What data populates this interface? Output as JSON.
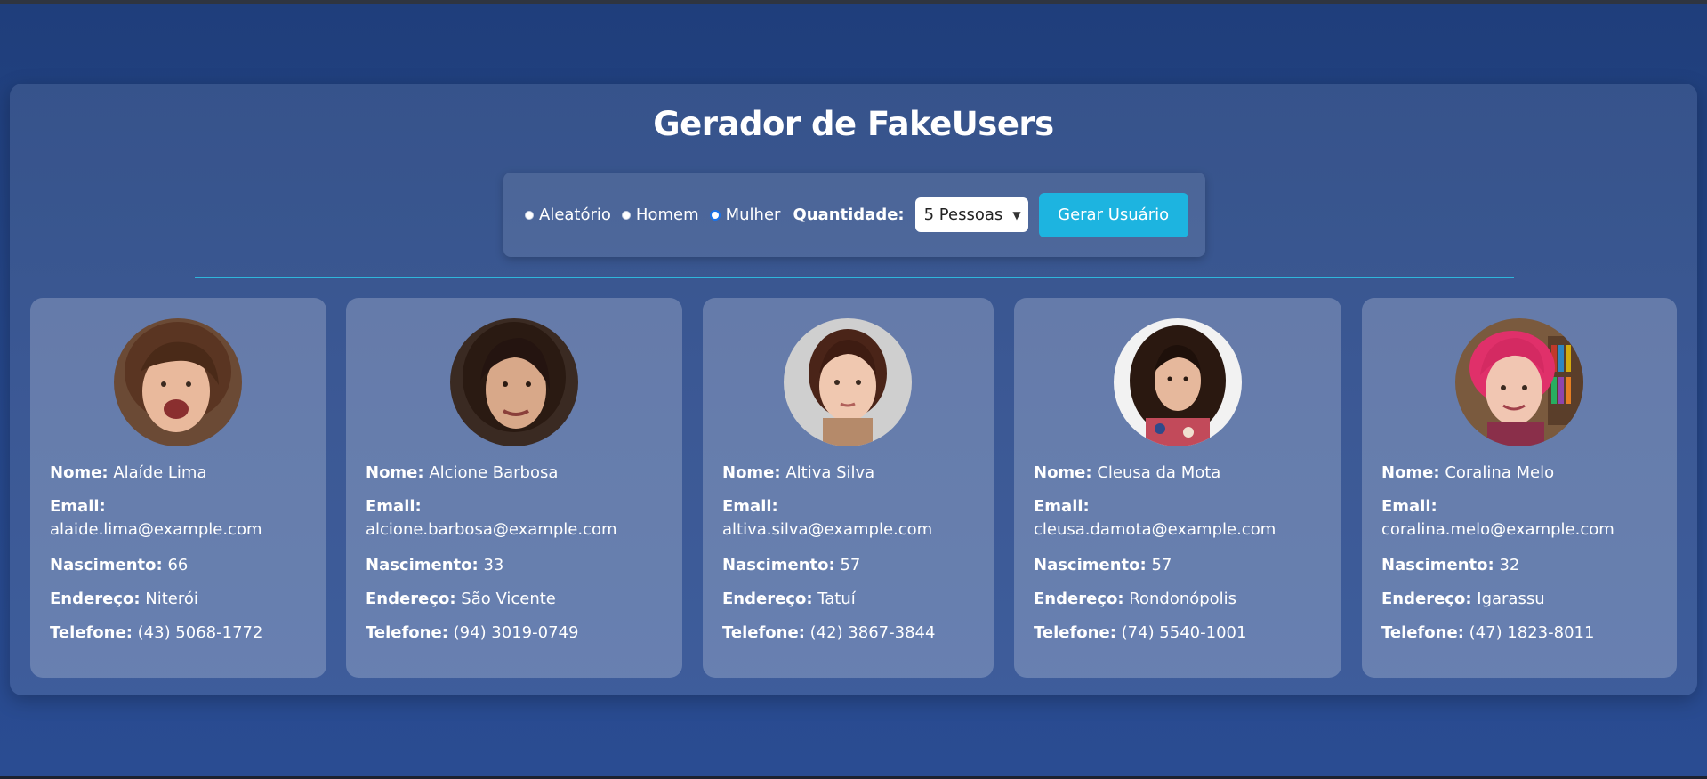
{
  "title": "Gerador de FakeUsers",
  "controls": {
    "gender_options": [
      "Aleatório",
      "Homem",
      "Mulher"
    ],
    "selected_gender": "Mulher",
    "quantity_label": "Quantidade:",
    "quantity_value": "5 Pessoas",
    "generate_button": "Gerar Usuário"
  },
  "labels": {
    "name": "Nome:",
    "email": "Email:",
    "birth": "Nascimento:",
    "address": "Endereço:",
    "phone": "Telefone:"
  },
  "users": [
    {
      "name": "Alaíde Lima",
      "email": "alaide.lima@example.com",
      "birth": "66",
      "address": "Niterói",
      "phone": "(43) 5068-1772"
    },
    {
      "name": "Alcione Barbosa",
      "email": "alcione.barbosa@example.com",
      "birth": "33",
      "address": "São Vicente",
      "phone": "(94) 3019-0749"
    },
    {
      "name": "Altiva Silva",
      "email": "altiva.silva@example.com",
      "birth": "57",
      "address": "Tatuí",
      "phone": "(42) 3867-3844"
    },
    {
      "name": "Cleusa da Mota",
      "email": "cleusa.damota@example.com",
      "birth": "57",
      "address": "Rondonópolis",
      "phone": "(74) 5540-1001"
    },
    {
      "name": "Coralina Melo",
      "email": "coralina.melo@example.com",
      "birth": "32",
      "address": "Igarassu",
      "phone": "(47) 1823-8011"
    }
  ],
  "colors": {
    "accent_button": "#1db4e0",
    "divider": "#2fb6db",
    "background": "#26478a"
  }
}
